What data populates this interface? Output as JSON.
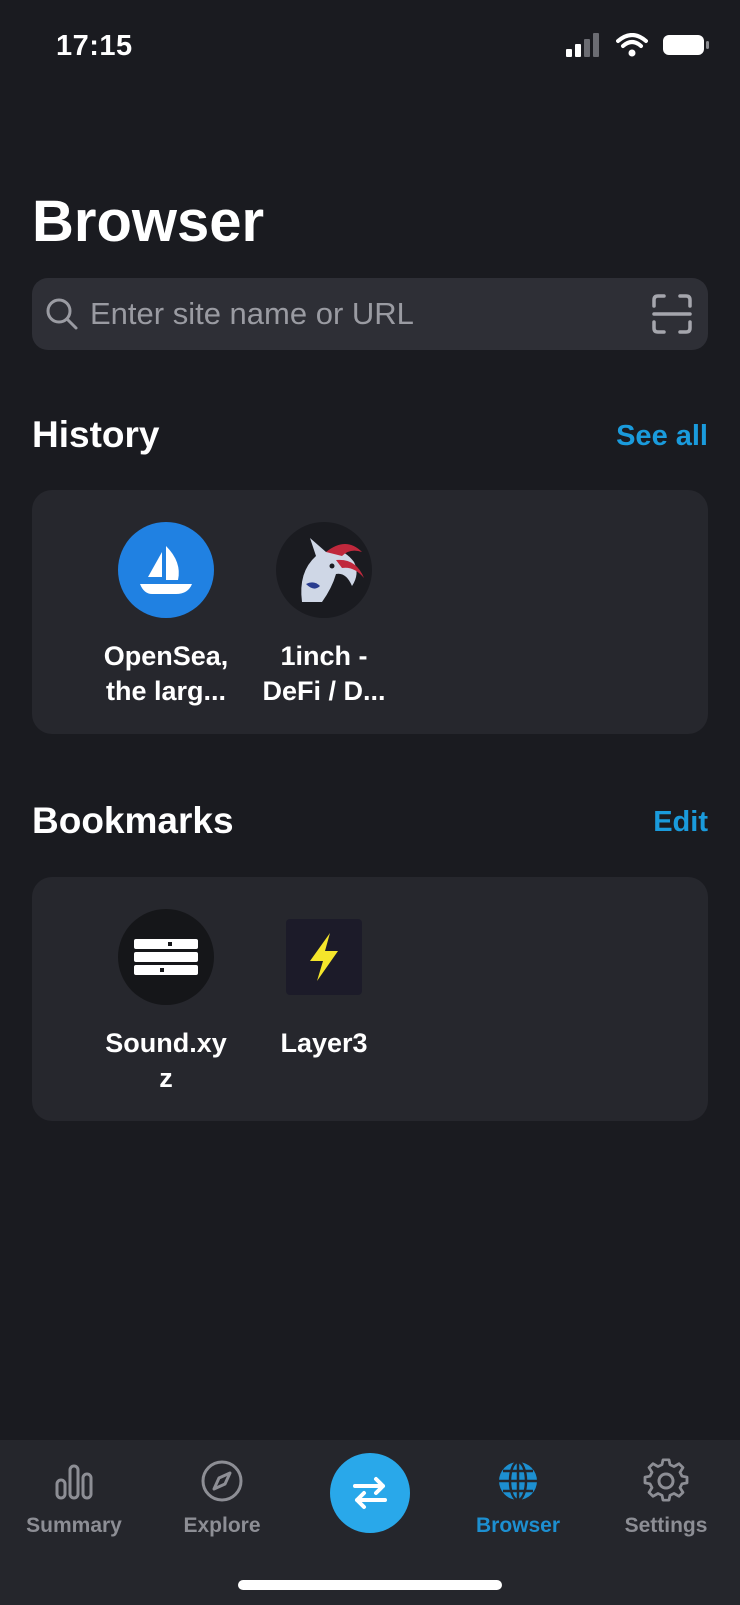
{
  "status_bar": {
    "time": "17:15"
  },
  "page": {
    "title": "Browser"
  },
  "search": {
    "placeholder": "Enter site name or URL"
  },
  "history": {
    "title": "History",
    "action": "See all",
    "items": [
      {
        "label_line1": "OpenSea,",
        "label_line2": "the larg...",
        "icon": "opensea-logo-icon"
      },
      {
        "label_line1": "1inch -",
        "label_line2": "DeFi / D...",
        "icon": "1inch-unicorn-logo-icon"
      }
    ]
  },
  "bookmarks": {
    "title": "Bookmarks",
    "action": "Edit",
    "items": [
      {
        "label_line1": "Sound.xy",
        "label_line2": "z",
        "icon": "sound-xyz-logo-icon"
      },
      {
        "label_line1": "Layer3",
        "label_line2": "",
        "icon": "layer3-lightning-icon"
      }
    ]
  },
  "tabs": [
    {
      "label": "Summary",
      "icon": "bar-chart-icon",
      "active": false
    },
    {
      "label": "Explore",
      "icon": "compass-icon",
      "active": false
    },
    {
      "label": "",
      "icon": "swap-arrows-icon",
      "active": false
    },
    {
      "label": "Browser",
      "icon": "globe-icon",
      "active": true
    },
    {
      "label": "Settings",
      "icon": "gear-icon",
      "active": false
    }
  ],
  "colors": {
    "background": "#1a1b20",
    "card": "#26272d",
    "accent": "#1a9bdc",
    "swap_button": "#29a8ea",
    "opensea_blue": "#2081e2",
    "layer3_yellow": "#f5e62b"
  }
}
